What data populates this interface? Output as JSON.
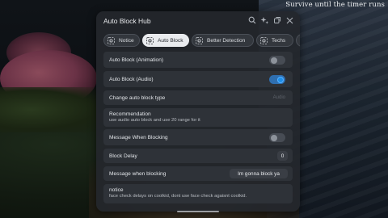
{
  "overlay": {
    "corner_text": "Survive until the timer runs"
  },
  "window": {
    "title": "Auto Block Hub",
    "icons": [
      "search-icon",
      "sparkles-icon",
      "copy-icon",
      "close-icon"
    ]
  },
  "tabs": [
    {
      "label": "Notice",
      "active": false
    },
    {
      "label": "Auto Block",
      "active": true
    },
    {
      "label": "Better Detection",
      "active": false
    },
    {
      "label": "Techs",
      "active": false
    }
  ],
  "settings": {
    "auto_block_animation": {
      "label": "Auto Block (Animation)",
      "enabled": false
    },
    "auto_block_audio": {
      "label": "Auto Block (Audio)",
      "enabled": true
    },
    "change_type": {
      "label": "Change auto block type",
      "value": "Audio"
    },
    "recommendation": {
      "title": "Recommendation",
      "body": "use audio auto block and use 20 range for it"
    },
    "message_when_blocking_toggle": {
      "label": "Message When Blocking",
      "enabled": false
    },
    "block_delay": {
      "label": "Block Delay",
      "value": "0"
    },
    "message_text": {
      "label": "Message when blocking",
      "value": "Im gonna block ya"
    },
    "notice": {
      "title": "notice",
      "body": "face check delays on coolkid, dont use face check agaisnt coolkid."
    }
  },
  "colors": {
    "accent": "#1e8ee8",
    "panel": "#24272c",
    "row": "#2e3238"
  }
}
